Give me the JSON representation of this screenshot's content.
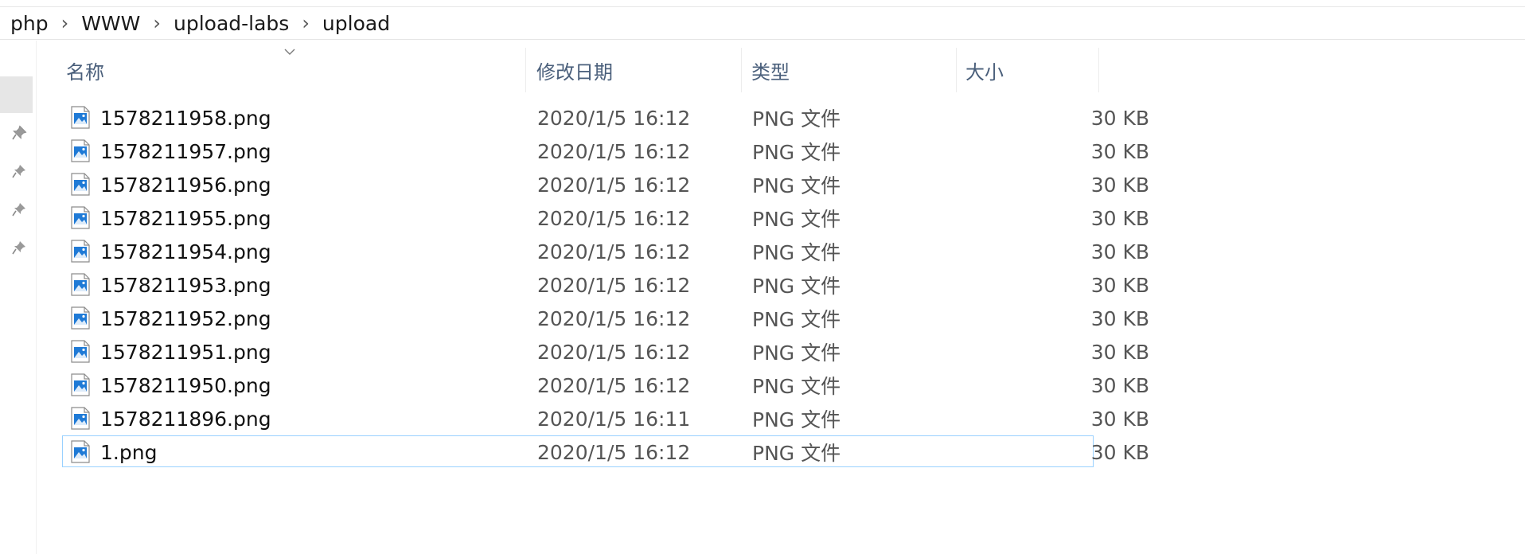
{
  "breadcrumb": [
    "php",
    "WWW",
    "upload-labs",
    "upload"
  ],
  "columns": {
    "name": "名称",
    "date": "修改日期",
    "type": "类型",
    "size": "大小"
  },
  "files": [
    {
      "name": "1578211958.png",
      "date": "2020/1/5 16:12",
      "type": "PNG 文件",
      "size": "30 KB"
    },
    {
      "name": "1578211957.png",
      "date": "2020/1/5 16:12",
      "type": "PNG 文件",
      "size": "30 KB"
    },
    {
      "name": "1578211956.png",
      "date": "2020/1/5 16:12",
      "type": "PNG 文件",
      "size": "30 KB"
    },
    {
      "name": "1578211955.png",
      "date": "2020/1/5 16:12",
      "type": "PNG 文件",
      "size": "30 KB"
    },
    {
      "name": "1578211954.png",
      "date": "2020/1/5 16:12",
      "type": "PNG 文件",
      "size": "30 KB"
    },
    {
      "name": "1578211953.png",
      "date": "2020/1/5 16:12",
      "type": "PNG 文件",
      "size": "30 KB"
    },
    {
      "name": "1578211952.png",
      "date": "2020/1/5 16:12",
      "type": "PNG 文件",
      "size": "30 KB"
    },
    {
      "name": "1578211951.png",
      "date": "2020/1/5 16:12",
      "type": "PNG 文件",
      "size": "30 KB"
    },
    {
      "name": "1578211950.png",
      "date": "2020/1/5 16:12",
      "type": "PNG 文件",
      "size": "30 KB"
    },
    {
      "name": "1578211896.png",
      "date": "2020/1/5 16:11",
      "type": "PNG 文件",
      "size": "30 KB"
    },
    {
      "name": "1.png",
      "date": "2020/1/5 16:12",
      "type": "PNG 文件",
      "size": "30 KB"
    }
  ],
  "icons": {
    "file": "png-file-icon",
    "pin": "pin-icon",
    "separator": "chevron-right-icon",
    "sort": "sort-chevron-down-icon"
  },
  "colors": {
    "header_text": "#4a5f7b",
    "focus_border": "#99d1ff",
    "icon_blue": "#1f7ad6"
  }
}
